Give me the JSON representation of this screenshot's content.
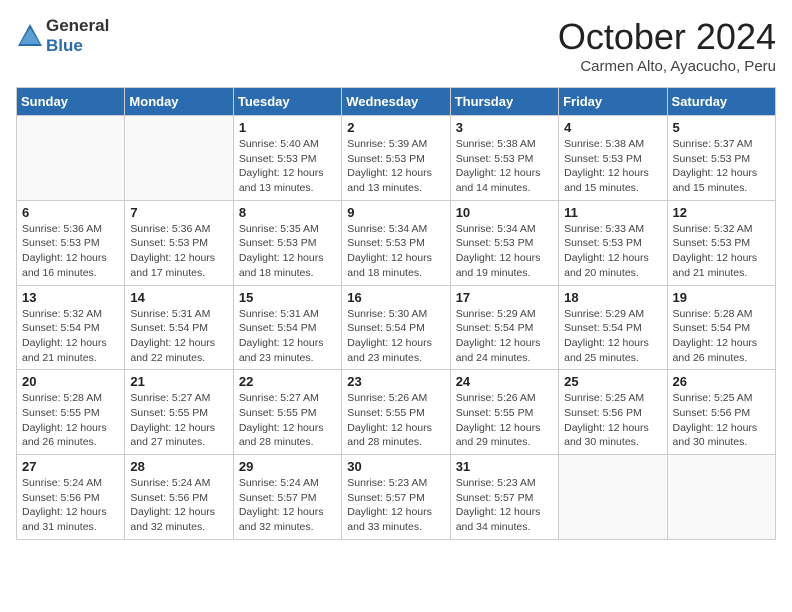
{
  "header": {
    "logo_general": "General",
    "logo_blue": "Blue",
    "month": "October 2024",
    "location": "Carmen Alto, Ayacucho, Peru"
  },
  "weekdays": [
    "Sunday",
    "Monday",
    "Tuesday",
    "Wednesday",
    "Thursday",
    "Friday",
    "Saturday"
  ],
  "weeks": [
    [
      {
        "day": "",
        "info": ""
      },
      {
        "day": "",
        "info": ""
      },
      {
        "day": "1",
        "sunrise": "5:40 AM",
        "sunset": "5:53 PM",
        "daylight": "12 hours and 13 minutes."
      },
      {
        "day": "2",
        "sunrise": "5:39 AM",
        "sunset": "5:53 PM",
        "daylight": "12 hours and 13 minutes."
      },
      {
        "day": "3",
        "sunrise": "5:38 AM",
        "sunset": "5:53 PM",
        "daylight": "12 hours and 14 minutes."
      },
      {
        "day": "4",
        "sunrise": "5:38 AM",
        "sunset": "5:53 PM",
        "daylight": "12 hours and 15 minutes."
      },
      {
        "day": "5",
        "sunrise": "5:37 AM",
        "sunset": "5:53 PM",
        "daylight": "12 hours and 15 minutes."
      }
    ],
    [
      {
        "day": "6",
        "sunrise": "5:36 AM",
        "sunset": "5:53 PM",
        "daylight": "12 hours and 16 minutes."
      },
      {
        "day": "7",
        "sunrise": "5:36 AM",
        "sunset": "5:53 PM",
        "daylight": "12 hours and 17 minutes."
      },
      {
        "day": "8",
        "sunrise": "5:35 AM",
        "sunset": "5:53 PM",
        "daylight": "12 hours and 18 minutes."
      },
      {
        "day": "9",
        "sunrise": "5:34 AM",
        "sunset": "5:53 PM",
        "daylight": "12 hours and 18 minutes."
      },
      {
        "day": "10",
        "sunrise": "5:34 AM",
        "sunset": "5:53 PM",
        "daylight": "12 hours and 19 minutes."
      },
      {
        "day": "11",
        "sunrise": "5:33 AM",
        "sunset": "5:53 PM",
        "daylight": "12 hours and 20 minutes."
      },
      {
        "day": "12",
        "sunrise": "5:32 AM",
        "sunset": "5:53 PM",
        "daylight": "12 hours and 21 minutes."
      }
    ],
    [
      {
        "day": "13",
        "sunrise": "5:32 AM",
        "sunset": "5:54 PM",
        "daylight": "12 hours and 21 minutes."
      },
      {
        "day": "14",
        "sunrise": "5:31 AM",
        "sunset": "5:54 PM",
        "daylight": "12 hours and 22 minutes."
      },
      {
        "day": "15",
        "sunrise": "5:31 AM",
        "sunset": "5:54 PM",
        "daylight": "12 hours and 23 minutes."
      },
      {
        "day": "16",
        "sunrise": "5:30 AM",
        "sunset": "5:54 PM",
        "daylight": "12 hours and 23 minutes."
      },
      {
        "day": "17",
        "sunrise": "5:29 AM",
        "sunset": "5:54 PM",
        "daylight": "12 hours and 24 minutes."
      },
      {
        "day": "18",
        "sunrise": "5:29 AM",
        "sunset": "5:54 PM",
        "daylight": "12 hours and 25 minutes."
      },
      {
        "day": "19",
        "sunrise": "5:28 AM",
        "sunset": "5:54 PM",
        "daylight": "12 hours and 26 minutes."
      }
    ],
    [
      {
        "day": "20",
        "sunrise": "5:28 AM",
        "sunset": "5:55 PM",
        "daylight": "12 hours and 26 minutes."
      },
      {
        "day": "21",
        "sunrise": "5:27 AM",
        "sunset": "5:55 PM",
        "daylight": "12 hours and 27 minutes."
      },
      {
        "day": "22",
        "sunrise": "5:27 AM",
        "sunset": "5:55 PM",
        "daylight": "12 hours and 28 minutes."
      },
      {
        "day": "23",
        "sunrise": "5:26 AM",
        "sunset": "5:55 PM",
        "daylight": "12 hours and 28 minutes."
      },
      {
        "day": "24",
        "sunrise": "5:26 AM",
        "sunset": "5:55 PM",
        "daylight": "12 hours and 29 minutes."
      },
      {
        "day": "25",
        "sunrise": "5:25 AM",
        "sunset": "5:56 PM",
        "daylight": "12 hours and 30 minutes."
      },
      {
        "day": "26",
        "sunrise": "5:25 AM",
        "sunset": "5:56 PM",
        "daylight": "12 hours and 30 minutes."
      }
    ],
    [
      {
        "day": "27",
        "sunrise": "5:24 AM",
        "sunset": "5:56 PM",
        "daylight": "12 hours and 31 minutes."
      },
      {
        "day": "28",
        "sunrise": "5:24 AM",
        "sunset": "5:56 PM",
        "daylight": "12 hours and 32 minutes."
      },
      {
        "day": "29",
        "sunrise": "5:24 AM",
        "sunset": "5:57 PM",
        "daylight": "12 hours and 32 minutes."
      },
      {
        "day": "30",
        "sunrise": "5:23 AM",
        "sunset": "5:57 PM",
        "daylight": "12 hours and 33 minutes."
      },
      {
        "day": "31",
        "sunrise": "5:23 AM",
        "sunset": "5:57 PM",
        "daylight": "12 hours and 34 minutes."
      },
      {
        "day": "",
        "info": ""
      },
      {
        "day": "",
        "info": ""
      }
    ]
  ],
  "labels": {
    "sunrise": "Sunrise:",
    "sunset": "Sunset:",
    "daylight": "Daylight:"
  }
}
